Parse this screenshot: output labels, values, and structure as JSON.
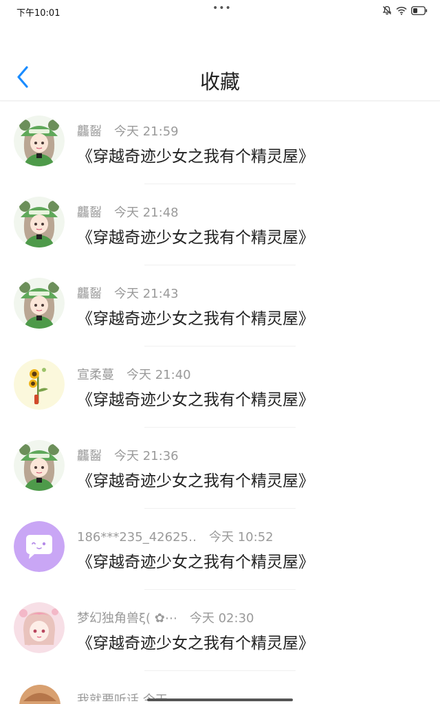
{
  "status": {
    "time": "下午10:01",
    "dots": "•••"
  },
  "header": {
    "title": "收藏"
  },
  "items": [
    {
      "user": "龘䶛",
      "time": "今天 21:59",
      "title": "《穿越奇迹少女之我有个精灵屋》",
      "avatar": "green-bear-girl"
    },
    {
      "user": "龘䶛",
      "time": "今天 21:48",
      "title": "《穿越奇迹少女之我有个精灵屋》",
      "avatar": "green-bear-girl"
    },
    {
      "user": "龘䶛",
      "time": "今天 21:43",
      "title": "《穿越奇迹少女之我有个精灵屋》",
      "avatar": "green-bear-girl"
    },
    {
      "user": "宣柔蔓",
      "time": "今天 21:40",
      "title": "《穿越奇迹少女之我有个精灵屋》",
      "avatar": "sunflower"
    },
    {
      "user": "龘䶛",
      "time": "今天 21:36",
      "title": "《穿越奇迹少女之我有个精灵屋》",
      "avatar": "green-bear-girl"
    },
    {
      "user": "186***235_42625‥",
      "time": "今天 10:52",
      "title": "《穿越奇迹少女之我有个精灵屋》",
      "avatar": "purple-chat"
    },
    {
      "user": "梦幻独角兽ξ( ✿⋯",
      "time": "今天 02:30",
      "title": "《穿越奇迹少女之我有个精灵屋》",
      "avatar": "pink-anime-girl"
    }
  ],
  "partial_item": {
    "text": "我就要听话 今天"
  },
  "colors": {
    "accent": "#1a8cff",
    "meta": "#9a9a9a",
    "text": "#222222",
    "purple_avatar": "#c9a6f5",
    "green_avatar": "#5fa85a"
  }
}
